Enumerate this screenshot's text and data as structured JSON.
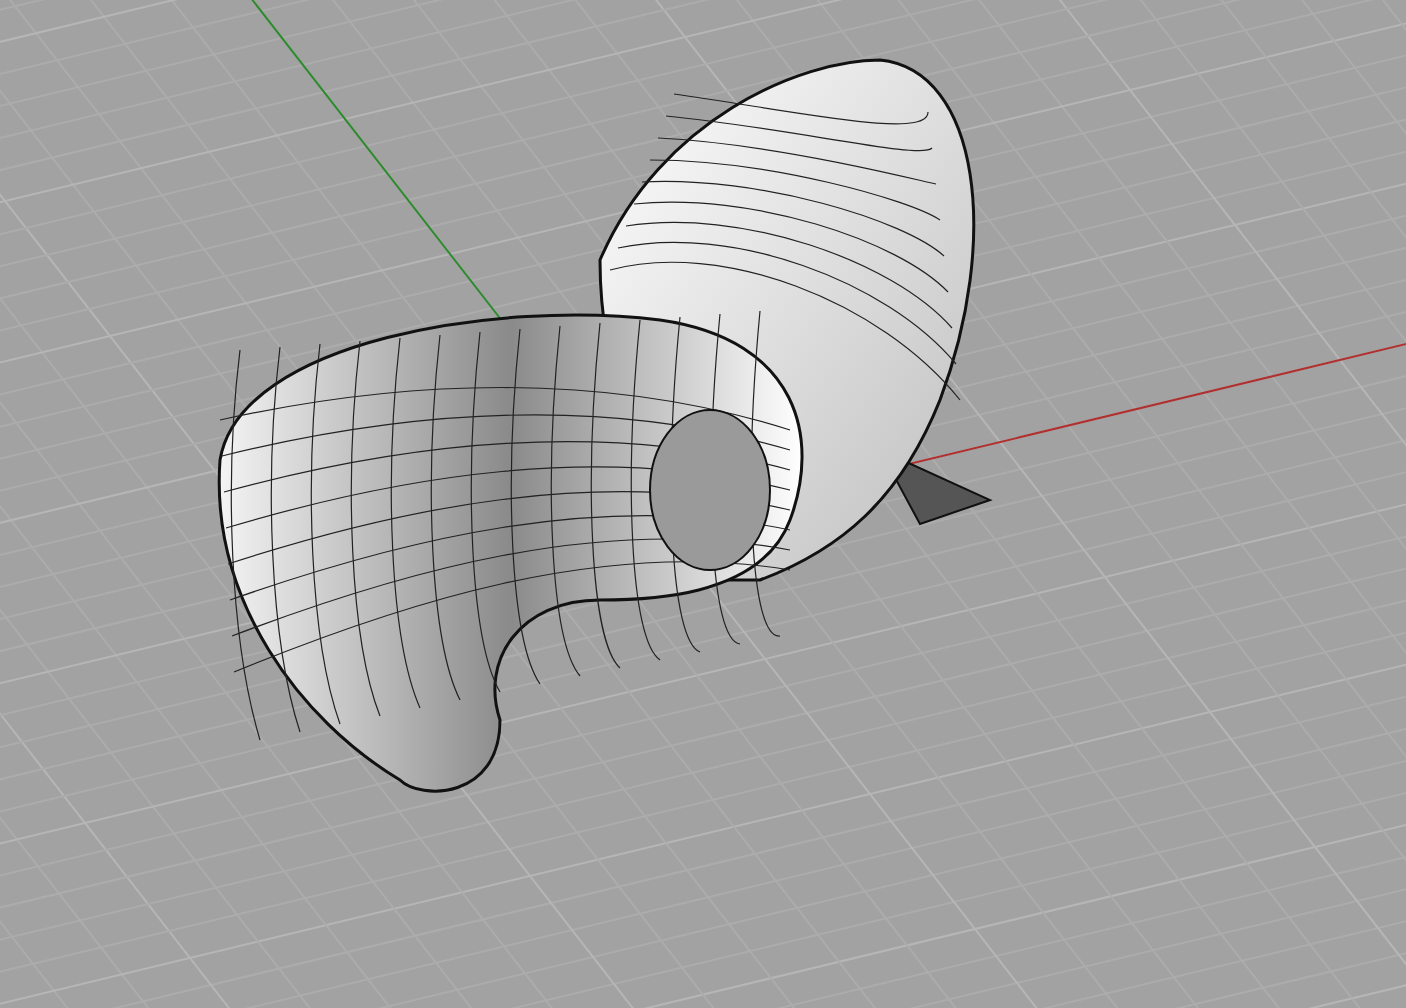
{
  "viewport": {
    "kind": "shaded",
    "grid": true,
    "axes": true
  }
}
